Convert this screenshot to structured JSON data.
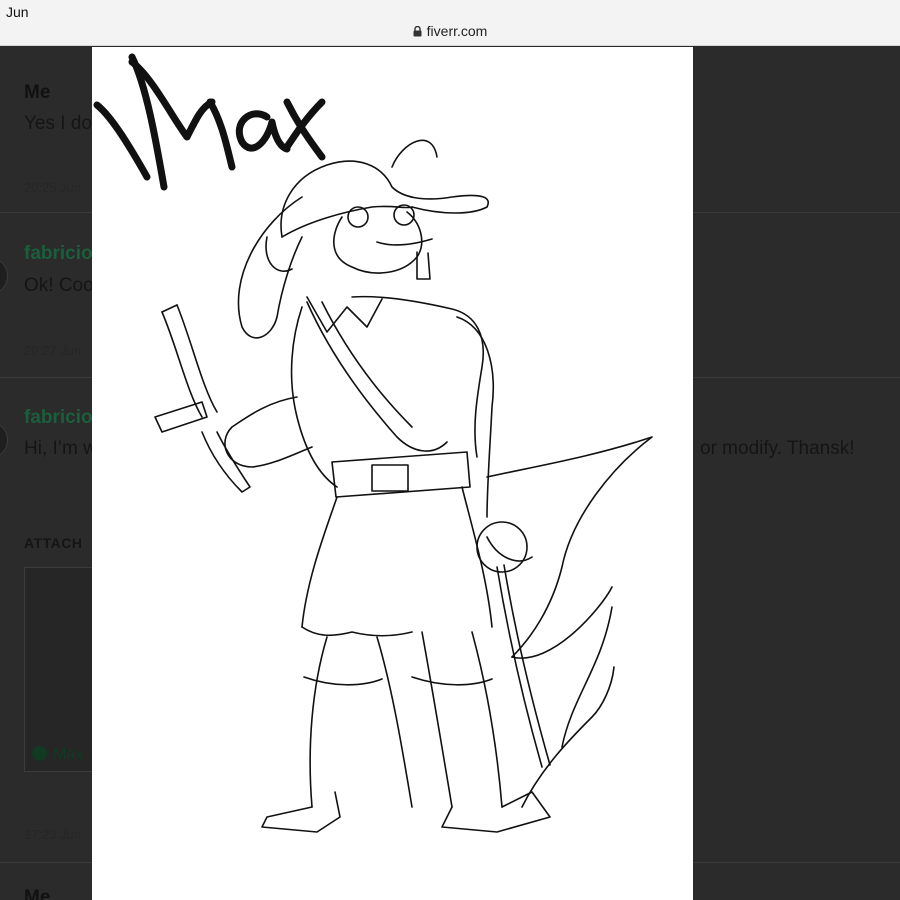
{
  "statusbar": {
    "time": "Jun"
  },
  "browser": {
    "url": "fiverr.com",
    "lock_icon": "lock-icon"
  },
  "conversation": {
    "messages": [
      {
        "sender": "Me",
        "text": "Yes I do",
        "time": "20:25 Jun"
      },
      {
        "sender": "fabricio",
        "text": "Ok! Coo",
        "time": "20:27 Jun"
      },
      {
        "sender": "fabricio",
        "text": "Hi, I’m w",
        "text_tail": "or modify. Thansk!",
        "time": "17:23 Jun"
      },
      {
        "sender": "Me",
        "text": ""
      }
    ],
    "attachments_label": "ATTACH",
    "attachment_file": "Max"
  },
  "image_viewer": {
    "caption": "Max"
  },
  "colors": {
    "background": "#2b2b2b",
    "fiverr_green": "#1dbf73",
    "viewer_bg": "#ffffff"
  }
}
